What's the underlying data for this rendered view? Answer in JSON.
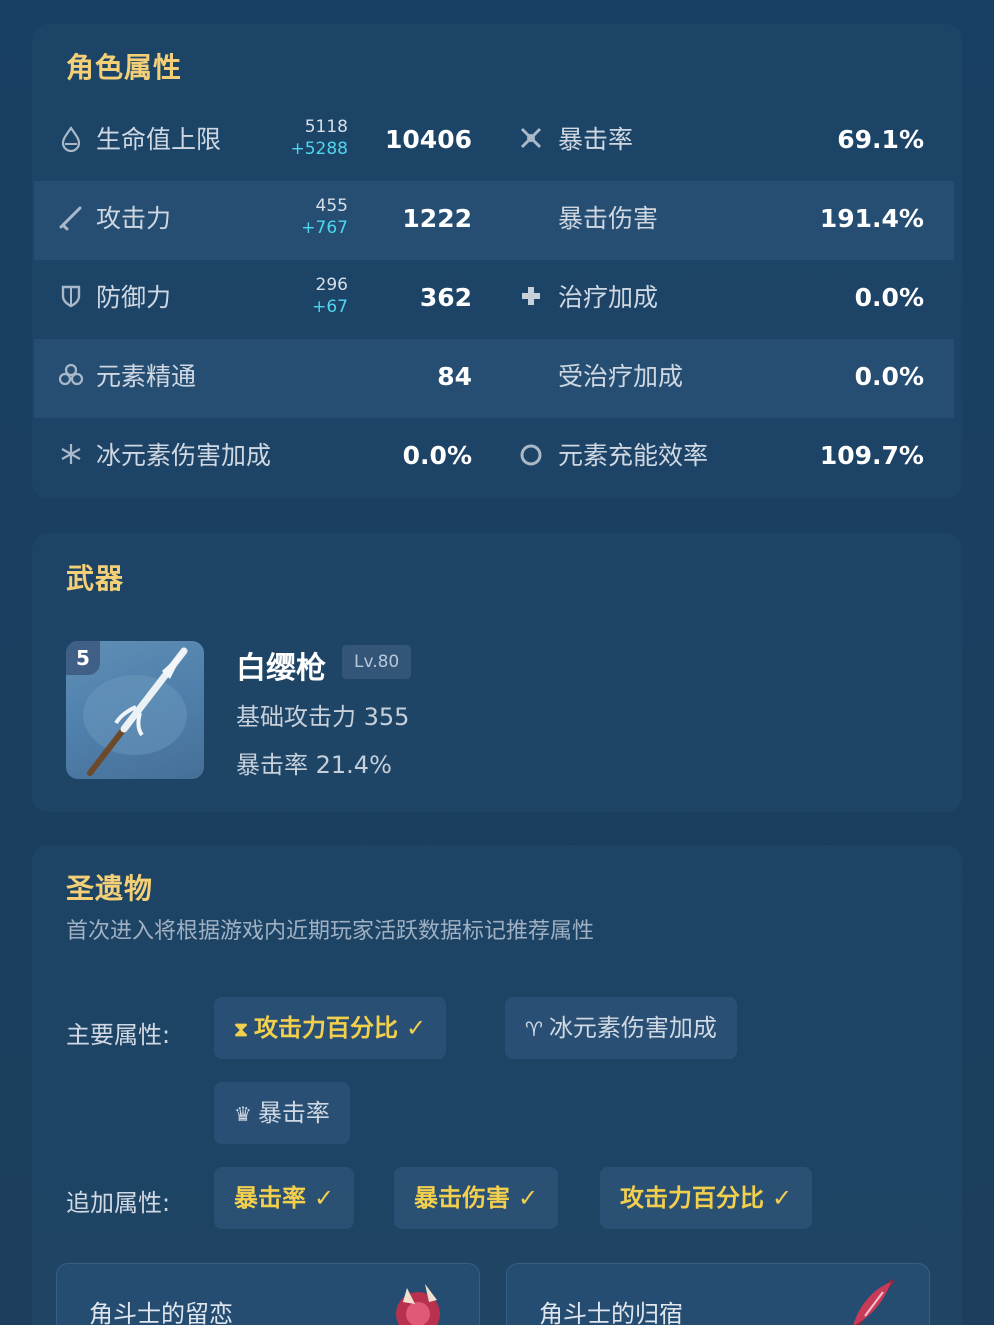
{
  "attributes": {
    "title": "角色属性",
    "rows": [
      {
        "left": {
          "icon": "hp-icon",
          "label": "生命值上限",
          "base": "5118",
          "bonus": "+5288",
          "value": "10406"
        },
        "right": {
          "icon": "crit-rate-icon",
          "label": "暴击率",
          "value": "69.1%"
        }
      },
      {
        "left": {
          "icon": "sword-icon",
          "label": "攻击力",
          "base": "455",
          "bonus": "+767",
          "value": "1222"
        },
        "right": {
          "icon": "",
          "label": "暴击伤害",
          "value": "191.4%"
        }
      },
      {
        "left": {
          "icon": "shield-icon",
          "label": "防御力",
          "base": "296",
          "bonus": "+67",
          "value": "362"
        },
        "right": {
          "icon": "healing-cross-icon",
          "label": "治疗加成",
          "value": "0.0%"
        }
      },
      {
        "left": {
          "icon": "elemental-mastery-icon",
          "label": "元素精通",
          "value": "84"
        },
        "right": {
          "icon": "",
          "label": "受治疗加成",
          "value": "0.0%"
        }
      },
      {
        "left": {
          "icon": "cryo-icon",
          "label": "冰元素伤害加成",
          "value": "0.0%"
        },
        "right": {
          "icon": "energy-recharge-icon",
          "label": "元素充能效率",
          "value": "109.7%"
        }
      }
    ]
  },
  "weapon": {
    "title": "武器",
    "rarity": "5",
    "name": "白缨枪",
    "level": "Lv.80",
    "base_atk": "基础攻击力 355",
    "sub_stat": "暴击率 21.4%"
  },
  "artifacts": {
    "title": "圣遗物",
    "subtitle": "首次进入将根据游戏内近期玩家活跃数据标记推荐属性",
    "main_label": "主要属性:",
    "sub_label": "追加属性:",
    "main_stats": [
      {
        "icon": "hourglass-icon",
        "label": "攻击力百分比",
        "selected": true
      },
      {
        "icon": "goblet-icon",
        "label": "冰元素伤害加成",
        "selected": false
      },
      {
        "icon": "crown-icon",
        "label": "暴击率",
        "selected": false
      }
    ],
    "sub_stats": [
      {
        "label": "暴击率",
        "selected": true
      },
      {
        "label": "暴击伤害",
        "selected": true
      },
      {
        "label": "攻击力百分比",
        "selected": true
      }
    ],
    "sets": [
      {
        "name": "角斗士的留恋"
      },
      {
        "name": "角斗士的归宿"
      }
    ],
    "check_mark": "✓"
  }
}
